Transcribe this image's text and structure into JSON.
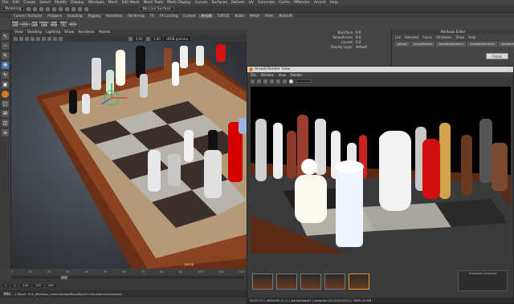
{
  "menubar": [
    "File",
    "Edit",
    "Create",
    "Select",
    "Modify",
    "Display",
    "Windows",
    "Mesh",
    "Edit Mesh",
    "Mesh Tools",
    "Mesh Display",
    "Curves",
    "Surfaces",
    "Deform",
    "UV",
    "Generate",
    "Cache",
    "MRender",
    "Arnold",
    "Help"
  ],
  "status": {
    "mode": "Modeling",
    "live_surface": "No Live Surface"
  },
  "shelf_tabs": [
    "Curves / Surfaces",
    "Polygons",
    "Sculpting",
    "Rigging",
    "Animation",
    "Rendering",
    "FX",
    "FX Caching",
    "Custom",
    "Arnold",
    "TURTLE",
    "Bullet",
    "MASH",
    "XGen",
    "Redshift"
  ],
  "shelf_active": "Arnold",
  "shelf_buttons": [
    "Mesh Light",
    "Skydome",
    "Area Light",
    "Photom Light",
    "Light Portal",
    "Stand In",
    "Render"
  ],
  "viewport": {
    "menu": [
      "View",
      "Shading",
      "Lighting",
      "Show",
      "Renderer",
      "Panels"
    ],
    "values": [
      "0.00",
      "1.00"
    ],
    "color_space": "sRGB gamma",
    "camera_label": "persp"
  },
  "attributes": [
    {
      "k": "Backface",
      "v": "0.0"
    },
    {
      "k": "Smoothness",
      "v": "0.0"
    },
    {
      "k": "Lineset",
      "v": "0.0"
    },
    {
      "k": "Display Layer",
      "v": "default"
    }
  ],
  "channelbox": {
    "title": "Attribute Editor",
    "menu": [
      "List",
      "Selected",
      "Focus",
      "Attributes",
      "Show",
      "Help"
    ],
    "objects": [
      "persp1",
      "perspShape2",
      "standardSurface1",
      "standardSurface2",
      "standardSurface3"
    ],
    "tooltip": "Focus"
  },
  "render_view": {
    "title": "Arnold Render View",
    "menu": [
      "File",
      "Window",
      "View",
      "Render"
    ],
    "snapshot_label": "Snapshot Comment",
    "status": "00:01:57 | 960x540 (1:1) | perspShape2 | samples [3/2/2/2/2/2/2] | 3965.34 MB"
  },
  "timeline": {
    "ticks": [
      "1",
      "10",
      "20",
      "30",
      "40",
      "50",
      "60",
      "70",
      "80",
      "90",
      "100",
      "110",
      "120"
    ],
    "start": "1",
    "end": "120"
  },
  "rangebar": [
    "1",
    "1",
    "120",
    "120",
    "200"
  ],
  "cmdline": {
    "lang": "MEL",
    "result": "// Result: D:/E_Windows/_Users/vaeeda/MayaDay2017/Arnold/cohen/scenes/..."
  },
  "colors": {
    "accent": "#e49a2a",
    "maya_bg": "#3c3c3c"
  }
}
